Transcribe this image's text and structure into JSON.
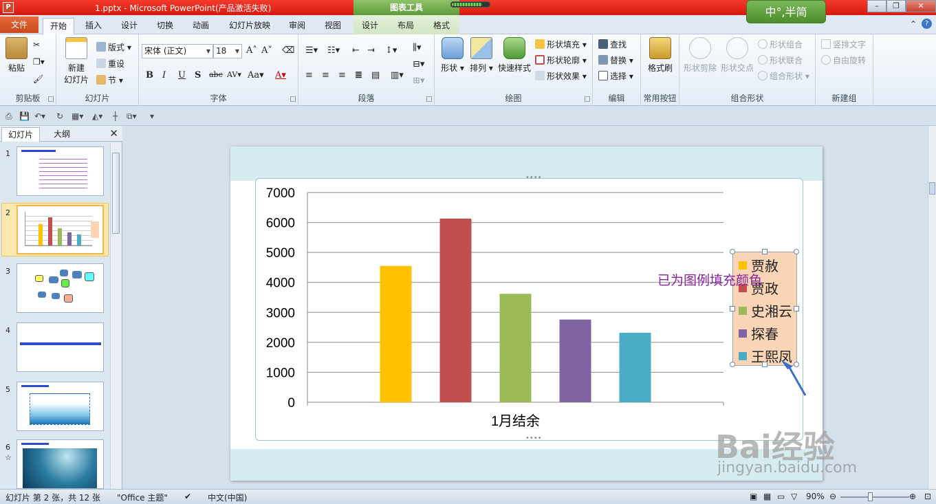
{
  "window": {
    "title": "1.pptx - Microsoft PowerPoint(产品激活失败)",
    "context_tools": "图表工具",
    "ime_logo": "中°,半简"
  },
  "tabs": [
    "文件",
    "开始",
    "插入",
    "设计",
    "切换",
    "动画",
    "幻灯片放映",
    "审阅",
    "视图",
    "设计",
    "布局",
    "格式"
  ],
  "ribbon": {
    "clipboard": {
      "paste": "粘贴",
      "label": "剪贴板"
    },
    "slides": {
      "new_slide": "新建",
      "new_slide2": "幻灯片",
      "layout": "版式",
      "reset": "重设",
      "section": "节",
      "label": "幻灯片"
    },
    "font": {
      "font_name": "宋体 (正文)",
      "font_size": "18",
      "label": "字体"
    },
    "paragraph": {
      "label": "段落"
    },
    "drawing": {
      "shapes": "形状",
      "arrange": "排列",
      "quick_styles": "快速样式",
      "shape_fill": "形状填充",
      "shape_outline": "形状轮廓",
      "shape_effects": "形状效果",
      "label": "绘图"
    },
    "editing": {
      "find": "查找",
      "replace": "替换",
      "select": "选择",
      "label": "编辑"
    },
    "common": {
      "format_painter": "格式刷",
      "label": "常用按钮"
    },
    "combine": {
      "shape_subtract": "形状剪除",
      "shape_intersect": "形状交点",
      "shape_combine": "形状组合",
      "shape_union": "形状联合",
      "combine_shapes": "组合形状",
      "label": "组合形状"
    },
    "newgroup": {
      "vertical_text": "竖排文字",
      "free_rotate": "自由旋转",
      "label": "新建组"
    }
  },
  "slides_pane": {
    "tabs": [
      "幻灯片",
      "大纲"
    ],
    "close": "✕",
    "numbers": [
      "1",
      "2",
      "3",
      "4",
      "5",
      "6"
    ],
    "slide6_mark": "☆"
  },
  "chart_data": {
    "type": "bar",
    "categories": [
      "1月结余"
    ],
    "series": [
      {
        "name": "贾赦",
        "values": [
          4550
        ],
        "color": "#ffc000"
      },
      {
        "name": "贾政",
        "values": [
          6130
        ],
        "color": "#c0504d"
      },
      {
        "name": "史湘云",
        "values": [
          3620
        ],
        "color": "#9bbb59"
      },
      {
        "name": "探春",
        "values": [
          2760
        ],
        "color": "#8064a2"
      },
      {
        "name": "王熙凤",
        "values": [
          2320
        ],
        "color": "#4bacc6"
      }
    ],
    "yticks": [
      "0",
      "1000",
      "2000",
      "3000",
      "4000",
      "5000",
      "6000",
      "7000"
    ],
    "ylim": [
      0,
      7000
    ],
    "grid": true,
    "legend_position": "right",
    "legend_fill": "#fbd5b5"
  },
  "annotation": "已为图例填充颜色",
  "watermark": {
    "main": "Bai经验",
    "sub": "jingyan.baidu.com"
  },
  "status": {
    "slide_info": "幻灯片 第 2 张，共 12 张",
    "theme": "\"Office 主题\"",
    "language": "中文(中国)",
    "zoom": "90%"
  }
}
